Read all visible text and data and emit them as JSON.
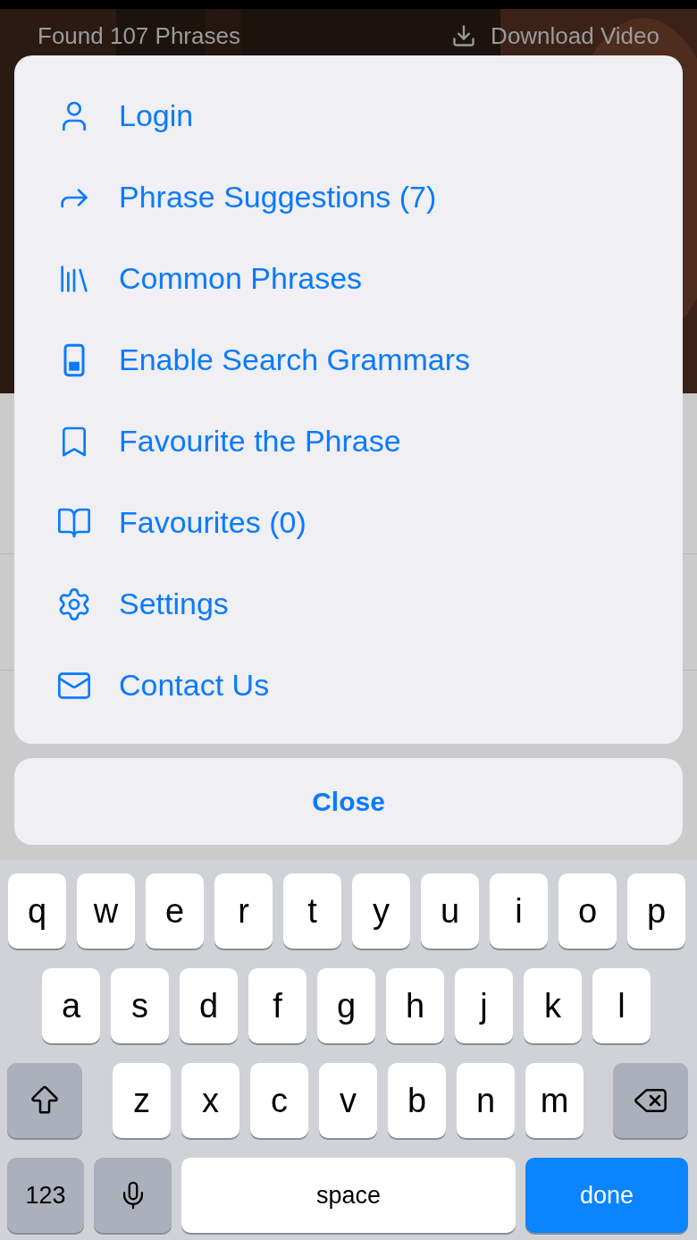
{
  "background": {
    "result_count": "Found 107 Phrases",
    "download_label": "Download Video"
  },
  "menu": {
    "items": [
      {
        "label": "Login"
      },
      {
        "label": "Phrase Suggestions (7)"
      },
      {
        "label": "Common Phrases"
      },
      {
        "label": "Enable Search Grammars"
      },
      {
        "label": "Favourite the Phrase"
      },
      {
        "label": "Favourites (0)"
      },
      {
        "label": "Settings"
      },
      {
        "label": "Contact Us"
      }
    ],
    "close": "Close"
  },
  "keyboard": {
    "rows": [
      [
        "q",
        "w",
        "e",
        "r",
        "t",
        "y",
        "u",
        "i",
        "o",
        "p"
      ],
      [
        "a",
        "s",
        "d",
        "f",
        "g",
        "h",
        "j",
        "k",
        "l"
      ],
      [
        "z",
        "x",
        "c",
        "v",
        "b",
        "n",
        "m"
      ]
    ],
    "numbers_key": "123",
    "space_key": "space",
    "return_key": "done"
  }
}
